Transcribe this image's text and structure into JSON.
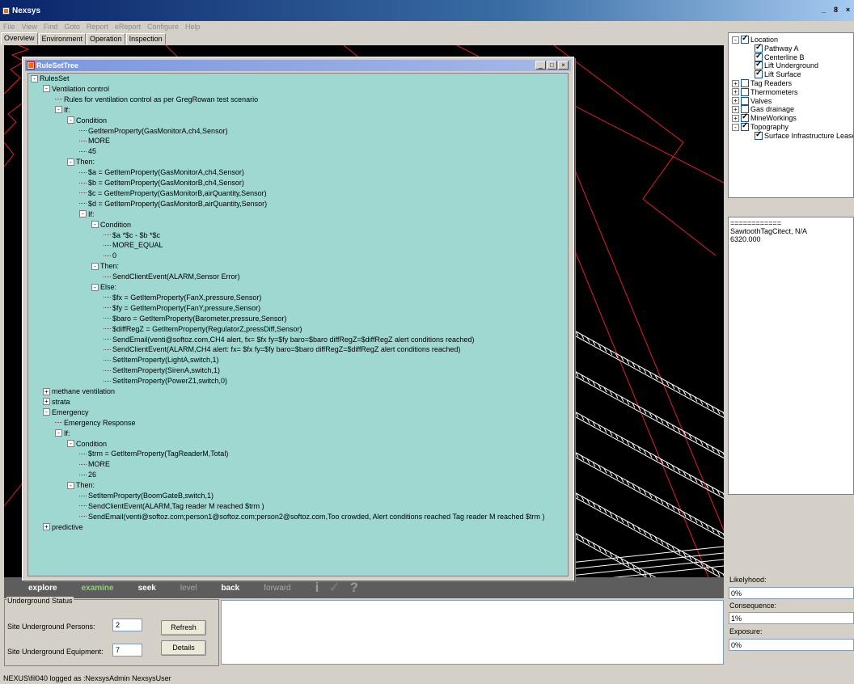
{
  "app": {
    "title": "Nexsys",
    "window_controls": [
      "_",
      "8",
      "×"
    ]
  },
  "menu": [
    "File",
    "View",
    "Find",
    "Goto",
    "Report",
    "eReport",
    "Configure",
    "Help"
  ],
  "tabs": [
    "Overview",
    "Environment",
    "Operation",
    "Inspection"
  ],
  "map_toolbar": {
    "buttons": [
      "explore",
      "examine",
      "seek",
      "level",
      "back",
      "forward"
    ],
    "active": "examine",
    "icons": [
      "i",
      "✓",
      "?"
    ]
  },
  "rule_window": {
    "title": "RuleSetTree",
    "controls": [
      "_",
      "□",
      "×"
    ],
    "rows": [
      {
        "d": 0,
        "t": "RulesSet",
        "e": "-"
      },
      {
        "d": 1,
        "t": "Ventilation control",
        "e": "-"
      },
      {
        "d": 2,
        "t": "Rules for ventilation control as per GregRowan test scenario",
        "e": ""
      },
      {
        "d": 2,
        "t": "If:",
        "e": "-"
      },
      {
        "d": 3,
        "t": "Condition",
        "e": "-"
      },
      {
        "d": 4,
        "t": "GetItemProperty(GasMonitorA,ch4,Sensor)",
        "e": ""
      },
      {
        "d": 4,
        "t": "MORE",
        "e": ""
      },
      {
        "d": 4,
        "t": "45",
        "e": ""
      },
      {
        "d": 3,
        "t": "Then:",
        "e": "-"
      },
      {
        "d": 4,
        "t": "$a = GetItemProperty(GasMonitorA,ch4,Sensor)",
        "e": ""
      },
      {
        "d": 4,
        "t": "$b = GetItemProperty(GasMonitorB,ch4,Sensor)",
        "e": ""
      },
      {
        "d": 4,
        "t": "$c = GetItemProperty(GasMonitorB,airQuantity,Sensor)",
        "e": ""
      },
      {
        "d": 4,
        "t": "$d = GetItemProperty(GasMonitorB,airQuantity,Sensor)",
        "e": ""
      },
      {
        "d": 4,
        "t": "If:",
        "e": "-"
      },
      {
        "d": 5,
        "t": "Condition",
        "e": "-"
      },
      {
        "d": 6,
        "t": "$a *$c - $b *$c",
        "e": ""
      },
      {
        "d": 6,
        "t": "MORE_EQUAL",
        "e": ""
      },
      {
        "d": 6,
        "t": "0",
        "e": ""
      },
      {
        "d": 5,
        "t": "Then:",
        "e": "-"
      },
      {
        "d": 6,
        "t": "SendClientEvent(ALARM,Sensor Error)",
        "e": ""
      },
      {
        "d": 5,
        "t": "Else:",
        "e": "-"
      },
      {
        "d": 6,
        "t": "$fx = GetItemProperty(FanX,pressure,Sensor)",
        "e": ""
      },
      {
        "d": 6,
        "t": "$fy = GetItemProperty(FanY,pressure,Sensor)",
        "e": ""
      },
      {
        "d": 6,
        "t": "$baro = GetItemProperty(Barometer,pressure,Sensor)",
        "e": ""
      },
      {
        "d": 6,
        "t": "$diffRegZ = GetItemProperty(RegulatorZ,pressDiff,Sensor)",
        "e": ""
      },
      {
        "d": 6,
        "t": "SendEmail(venti@softoz.com,CH4 alert, fx= $fx fy=$fy baro=$baro diffRegZ=$diffRegZ alert conditions reached)",
        "e": ""
      },
      {
        "d": 6,
        "t": "SendClientEvent(ALARM,CH4 alert: fx= $fx fy=$fy baro=$baro diffRegZ=$diffRegZ alert conditions reached)",
        "e": ""
      },
      {
        "d": 6,
        "t": "SetItemProperty(LightA,switch,1)",
        "e": ""
      },
      {
        "d": 6,
        "t": "SetItemProperty(SirenA,switch,1)",
        "e": ""
      },
      {
        "d": 6,
        "t": "SetItemProperty(PowerZ1,switch,0)",
        "e": ""
      },
      {
        "d": 1,
        "t": "methane ventilation",
        "e": "+"
      },
      {
        "d": 1,
        "t": "strata",
        "e": "+"
      },
      {
        "d": 1,
        "t": "Emergency",
        "e": "-"
      },
      {
        "d": 2,
        "t": "Emergency Response",
        "e": ""
      },
      {
        "d": 2,
        "t": "If:",
        "e": "-"
      },
      {
        "d": 3,
        "t": "Condition",
        "e": "-"
      },
      {
        "d": 4,
        "t": "$trm = GetItemProperty(TagReaderM,Total)",
        "e": ""
      },
      {
        "d": 4,
        "t": "MORE",
        "e": ""
      },
      {
        "d": 4,
        "t": "26",
        "e": ""
      },
      {
        "d": 3,
        "t": "Then:",
        "e": "-"
      },
      {
        "d": 4,
        "t": "SetItemProperty(BoomGateB,switch,1)",
        "e": ""
      },
      {
        "d": 4,
        "t": "SendClientEvent(ALARM,Tag reader M reached $trm )",
        "e": ""
      },
      {
        "d": 4,
        "t": "SendEmail(venti@softoz.com;person1@softoz.com;person2@softoz.com,Too crowded, Alert conditions reached Tag reader M reached $trm )",
        "e": ""
      },
      {
        "d": 1,
        "t": "predictive",
        "e": "+"
      }
    ]
  },
  "layer_tree": [
    {
      "d": 0,
      "t": "Location",
      "e": "-",
      "c": true
    },
    {
      "d": 1,
      "t": "Pathway A",
      "e": "",
      "c": true
    },
    {
      "d": 1,
      "t": "Centerline B",
      "e": "",
      "c": true
    },
    {
      "d": 1,
      "t": "Lift Underground",
      "e": "",
      "c": true
    },
    {
      "d": 1,
      "t": "Lift Surface",
      "e": "",
      "c": true
    },
    {
      "d": 0,
      "t": "Tag Readers",
      "e": "+",
      "c": false
    },
    {
      "d": 0,
      "t": "Thermometers",
      "e": "+",
      "c": false
    },
    {
      "d": 0,
      "t": "Valves",
      "e": "+",
      "c": false
    },
    {
      "d": 0,
      "t": "Gas drainage",
      "e": "+",
      "c": false
    },
    {
      "d": 0,
      "t": "MineWorkings",
      "e": "+",
      "c": true
    },
    {
      "d": 0,
      "t": "Topography",
      "e": "-",
      "c": true
    },
    {
      "d": 1,
      "t": "Surface Infrastructure Lease",
      "e": "",
      "c": true
    }
  ],
  "info_pane": {
    "line1": "============",
    "line2": "SawtoothTagCitect, N/A",
    "line3": "6320.000"
  },
  "risk": {
    "likelihood_label": "Likelyhood:",
    "likelihood_value": "0%",
    "consequence_label": "Consequence:",
    "consequence_value": "1%",
    "exposure_label": "Exposure:",
    "exposure_value": "0%"
  },
  "underground": {
    "legend": "Underground Status",
    "persons_label": "Site Underground Persons:",
    "persons_value": "2",
    "equipment_label": "Site Underground Equipment:",
    "equipment_value": "7",
    "refresh_label": "Refresh",
    "details_label": "Details"
  },
  "status_text": "NEXUS\\fil040 logged as :NexsysAdmin NexsysUser",
  "colors": {
    "map_bg": "#000000",
    "map_red": "#e0202a",
    "map_white": "#ffffff",
    "tree_bg": "#9fd8d1",
    "title_blue": "#0a246a"
  }
}
